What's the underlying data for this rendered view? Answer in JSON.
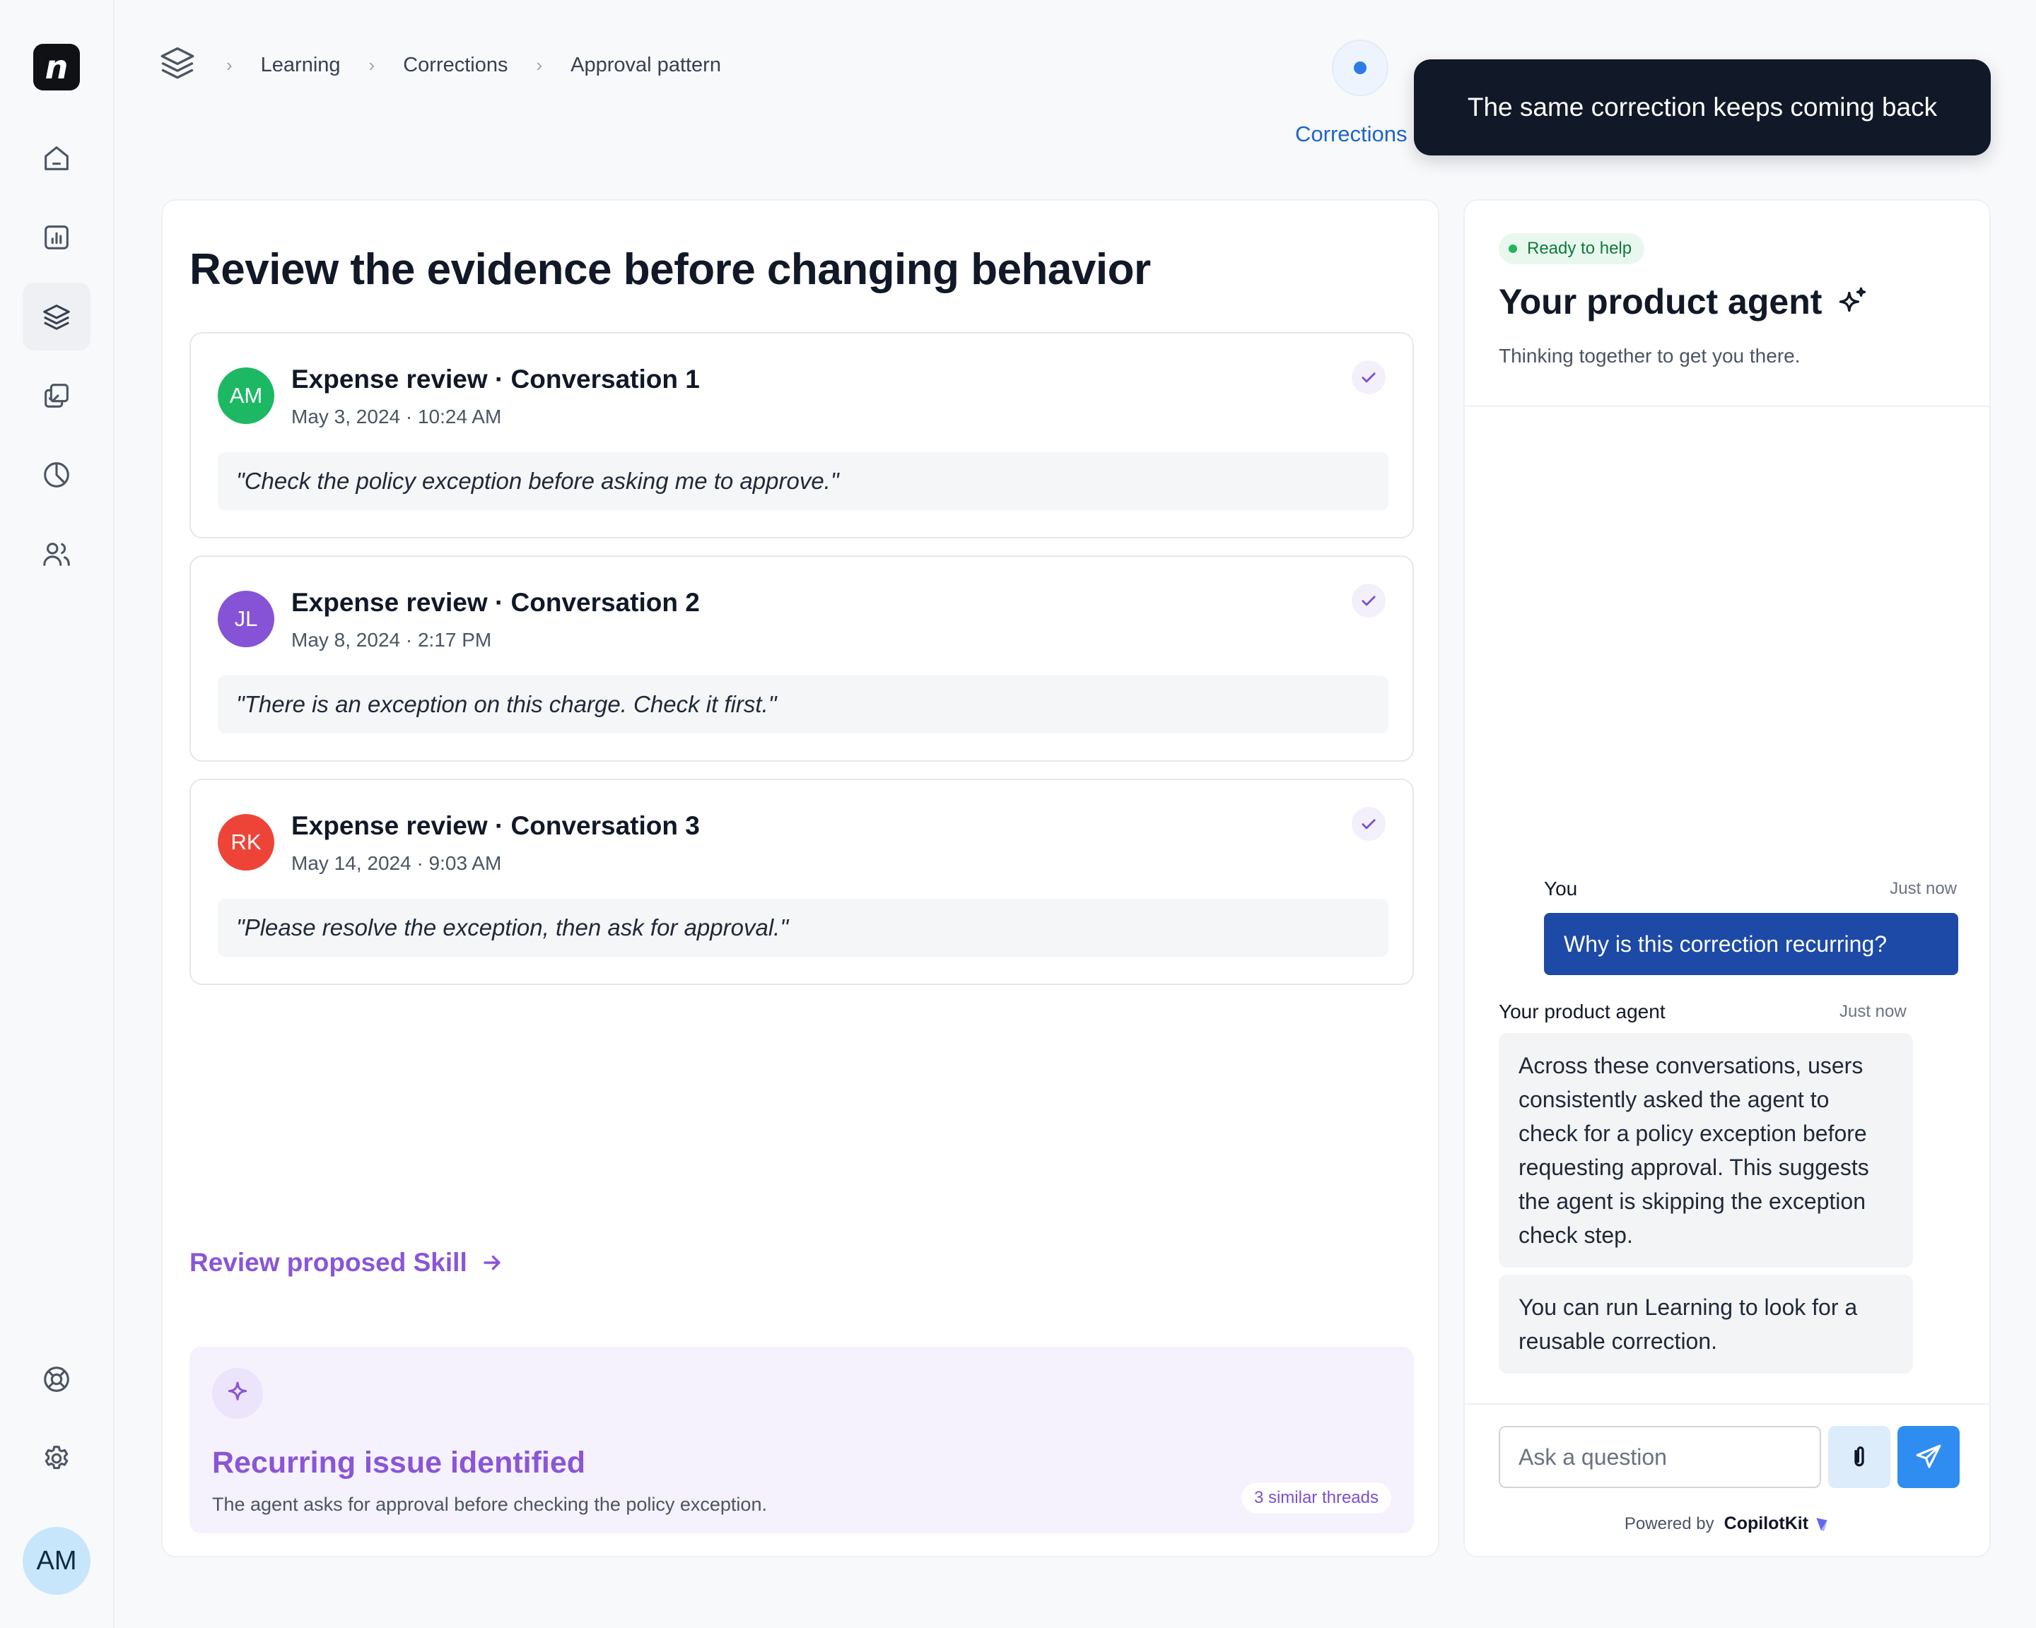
{
  "app": {
    "logo_letter": "n",
    "user_initials": "AM"
  },
  "sidebar": {
    "items": [
      {
        "name": "home",
        "icon": "home-icon",
        "active": false
      },
      {
        "name": "analytics",
        "icon": "bar-chart-icon",
        "active": false
      },
      {
        "name": "learning",
        "icon": "layers-icon",
        "active": true
      },
      {
        "name": "tasks",
        "icon": "copy-check-icon",
        "active": false
      },
      {
        "name": "reports",
        "icon": "pie-chart-icon",
        "active": false
      },
      {
        "name": "users",
        "icon": "users-icon",
        "active": false
      }
    ],
    "bottom": [
      {
        "name": "help",
        "icon": "lifebuoy-icon"
      },
      {
        "name": "settings",
        "icon": "gear-icon"
      }
    ]
  },
  "breadcrumb": [
    "Learning",
    "Corrections",
    "Approval pattern"
  ],
  "tab": {
    "label": "Corrections"
  },
  "tooltip": {
    "text": "The same correction keeps coming back"
  },
  "main": {
    "title": "Review the evidence before changing behavior",
    "conversations": [
      {
        "initials": "AM",
        "color": "#1db863",
        "title": "Expense review · Conversation 1",
        "date": "May 3, 2024 · 10:24 AM",
        "quote": "\"Check the policy exception before asking me to approve.\""
      },
      {
        "initials": "JL",
        "color": "#8652d6",
        "title": "Expense review · Conversation 2",
        "date": "May 8, 2024 · 2:17 PM",
        "quote": "\"There is an exception on this charge. Check it first.\""
      },
      {
        "initials": "RK",
        "color": "#ee4438",
        "title": "Expense review · Conversation 3",
        "date": "May 14, 2024 · 9:03 AM",
        "quote": "\"Please resolve the exception, then ask for approval.\""
      }
    ],
    "review_link": "Review proposed Skill",
    "issue": {
      "title": "Recurring issue identified",
      "description": "The agent asks for approval before checking the policy exception.",
      "badge": "3 similar threads"
    }
  },
  "agent": {
    "status": "Ready to help",
    "title": "Your product agent",
    "subtitle": "Thinking together to get you there.",
    "messages": {
      "you": {
        "name": "You",
        "time": "Just now",
        "text": "Why is this correction recurring?"
      },
      "agent": {
        "name": "Your product agent",
        "time": "Just now",
        "text1": "Across these conversations, users consistently asked the agent to check for a policy exception before requesting approval. This suggests the agent is skipping the exception check step.",
        "text2": "You can run Learning to look for a reusable correction."
      }
    },
    "input_placeholder": "Ask a question",
    "powered_by": "Powered by",
    "powered_brand": "CopilotKit"
  }
}
